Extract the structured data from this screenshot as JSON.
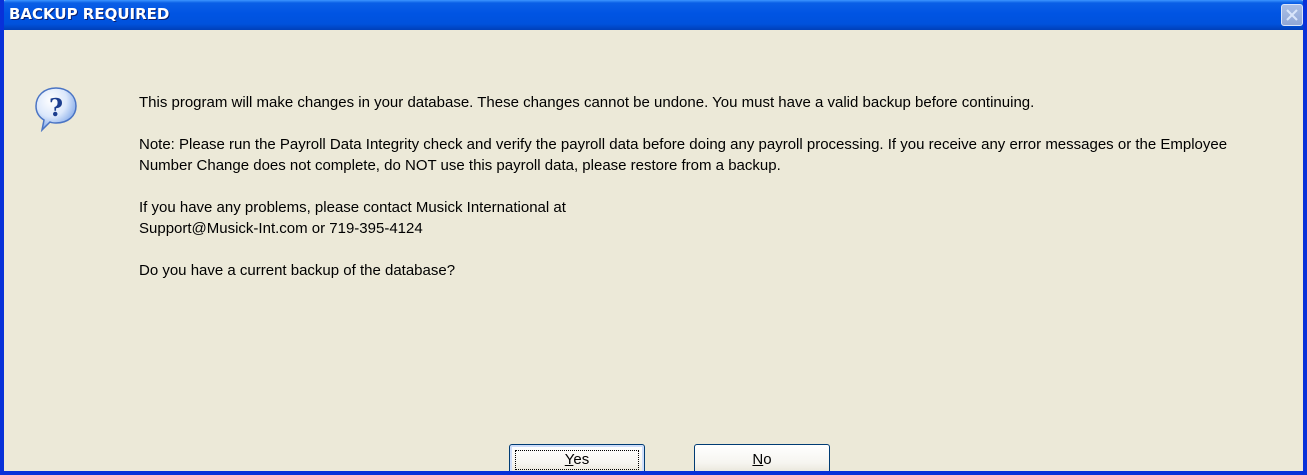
{
  "window": {
    "title": "BACKUP REQUIRED",
    "close_icon": "close-icon",
    "accent_color": "#0054e3"
  },
  "icon": {
    "name": "question-icon"
  },
  "message": {
    "paragraph1": "This program will make changes in your database.  These changes cannot be undone. You must have a valid backup before continuing.",
    "paragraph2": "Note: Please run the Payroll Data Integrity check and verify the payroll data before doing any payroll processing. If you receive any error messages or the Employee Number Change does not complete, do NOT use this payroll data, please restore from a backup.",
    "paragraph3_line1": "If you have any problems, please contact Musick International at",
    "paragraph3_line2": "Support@Musick-Int.com or 719-395-4124",
    "question": "Do you have a current backup of the database?"
  },
  "buttons": {
    "yes_mnemonic": "Y",
    "yes_rest": "es",
    "no_mnemonic": "N",
    "no_rest": "o"
  }
}
